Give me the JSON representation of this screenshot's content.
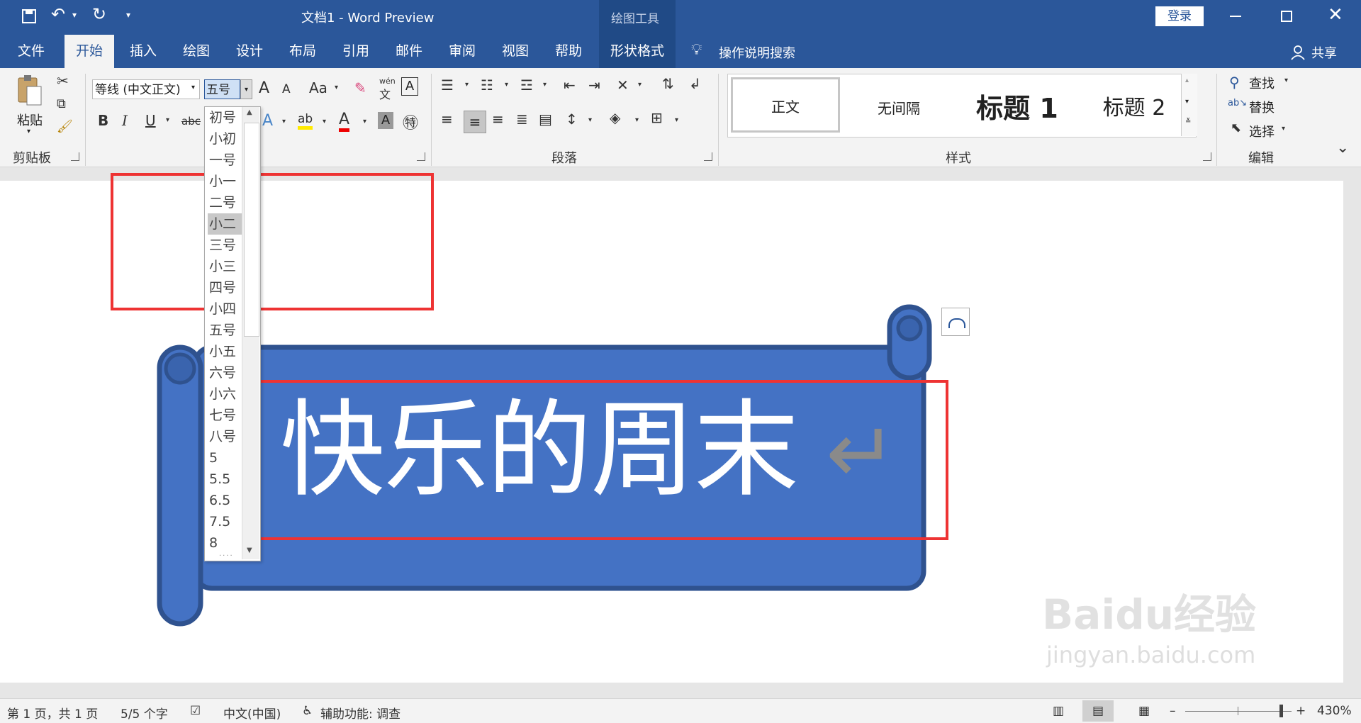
{
  "titlebar": {
    "doc_title": "文档1  -  Word Preview",
    "context_label": "绘图工具",
    "login_label": "登录",
    "minimize_icon": "minimize-icon",
    "restore_icon": "restore-icon",
    "close_icon": "close-icon"
  },
  "tabs": [
    {
      "label": "文件"
    },
    {
      "label": "开始"
    },
    {
      "label": "插入"
    },
    {
      "label": "绘图"
    },
    {
      "label": "设计"
    },
    {
      "label": "布局"
    },
    {
      "label": "引用"
    },
    {
      "label": "邮件"
    },
    {
      "label": "审阅"
    },
    {
      "label": "视图"
    },
    {
      "label": "帮助"
    },
    {
      "label": "形状格式"
    }
  ],
  "search": {
    "label": "操作说明搜索"
  },
  "share": {
    "label": "共享"
  },
  "ribbon": {
    "clipboard": {
      "paste_label": "粘贴",
      "group_label": "剪贴板"
    },
    "font": {
      "font_name": "等线 (中文正文)",
      "font_size": "五号",
      "grow": "A",
      "shrink": "A",
      "change_case": "Aa",
      "bold": "B",
      "italic": "I",
      "underline": "U",
      "strike": "abc",
      "pinyin_top": "wén",
      "pinyin_bottom": "文"
    },
    "paragraph": {
      "group_label": "段落"
    },
    "styles": {
      "group_label": "样式",
      "items": [
        "正文",
        "无间隔",
        "标题 1",
        "标题 2"
      ]
    },
    "editing": {
      "group_label": "编辑",
      "find": "查找",
      "replace": "替换",
      "select": "选择"
    }
  },
  "size_dropdown": {
    "items": [
      "初号",
      "小初",
      "一号",
      "小一",
      "二号",
      "小二",
      "三号",
      "小三",
      "四号",
      "小四",
      "五号",
      "小五",
      "六号",
      "小六",
      "七号",
      "八号",
      "5",
      "5.5",
      "6.5",
      "7.5",
      "8"
    ],
    "selected": "小二"
  },
  "document": {
    "banner_text": "快乐的周末",
    "paragraph_mark": "↵",
    "banner_color": "#4472c4",
    "banner_border": "#2f528f"
  },
  "statusbar": {
    "page": "第 1 页，共 1 页",
    "words": "5/5 个字",
    "language": "中文(中国)",
    "accessibility": "辅助功能: 调查",
    "zoom": "430%"
  },
  "watermark": {
    "text": "Baidu经验",
    "sub": "jingyan.baidu.com"
  },
  "colors": {
    "accent": "#2b579a",
    "highlight_red": "#e33333"
  }
}
